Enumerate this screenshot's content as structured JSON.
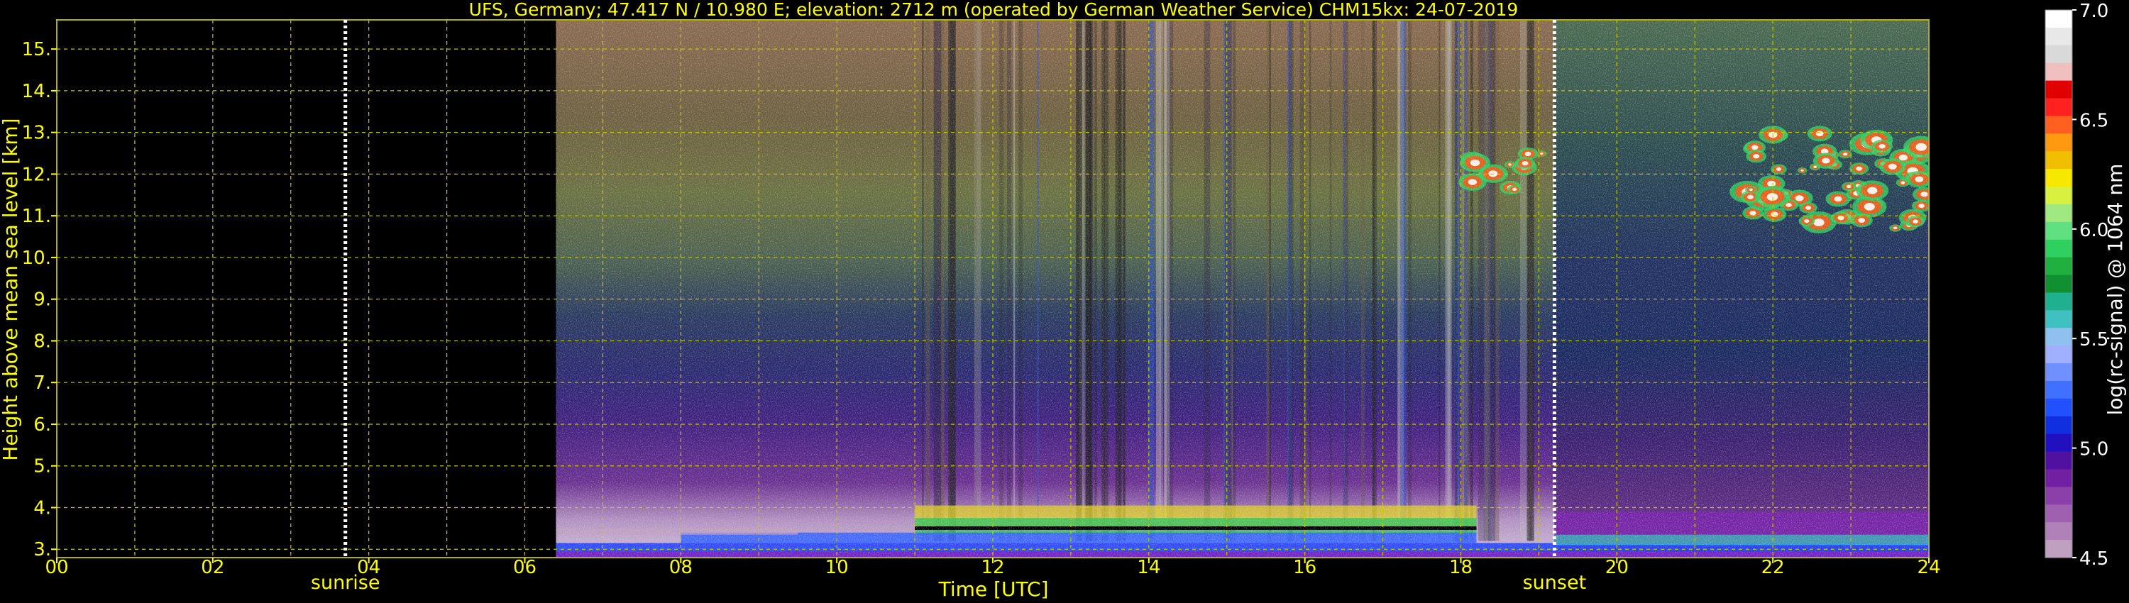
{
  "chart_data": {
    "type": "heatmap",
    "title": "UFS, Germany; 47.417 N / 10.980 E; elevation: 2712 m  (operated by German Weather Service)    CHM15kx: 24-07-2019",
    "xlabel": "Time [UTC]",
    "ylabel": "Height above mean sea level [km]",
    "xlim": [
      0,
      24
    ],
    "ylim": [
      2.8,
      15.7
    ],
    "x_ticks": [
      "00",
      "02",
      "04",
      "06",
      "08",
      "10",
      "12",
      "14",
      "16",
      "18",
      "20",
      "22",
      "24"
    ],
    "y_ticks": [
      "3.",
      "4.",
      "5.",
      "6.",
      "7.",
      "8.",
      "9.",
      "10.",
      "11.",
      "12.",
      "13.",
      "14.",
      "15."
    ],
    "grid": true,
    "data_start_hour": 6.4,
    "annotations": [
      {
        "label": "sunrise",
        "x": 3.7
      },
      {
        "label": "sunset",
        "x": 19.2
      }
    ],
    "colorbar": {
      "label": "log(rc-signal) @ 1064 nm",
      "range": [
        4.5,
        7.0
      ],
      "ticks": [
        "7.0",
        "6.5",
        "6.0",
        "5.5",
        "5.0",
        "4.5"
      ],
      "colors": [
        "#ffffff",
        "#e8e8e8",
        "#d9d9d9",
        "#f0c0c0",
        "#e00000",
        "#ff2020",
        "#ff6020",
        "#ff9a10",
        "#f0c000",
        "#f6e800",
        "#d8f040",
        "#a0e880",
        "#60e080",
        "#30d060",
        "#20b040",
        "#109030",
        "#20b090",
        "#40c0c0",
        "#90c0f0",
        "#a0b0ff",
        "#7090ff",
        "#4070ff",
        "#2050ff",
        "#1030e0",
        "#2010c0",
        "#5010a0",
        "#7020a0",
        "#8a40a8",
        "#a060b0",
        "#b080b8",
        "#c0a0c0"
      ]
    },
    "cloud_layers": [
      {
        "start": 18.1,
        "end": 19.1,
        "height_min": 11.6,
        "height_max": 12.5
      },
      {
        "start": 21.6,
        "end": 24.0,
        "height_min": 10.7,
        "height_max": 13.0
      }
    ]
  }
}
